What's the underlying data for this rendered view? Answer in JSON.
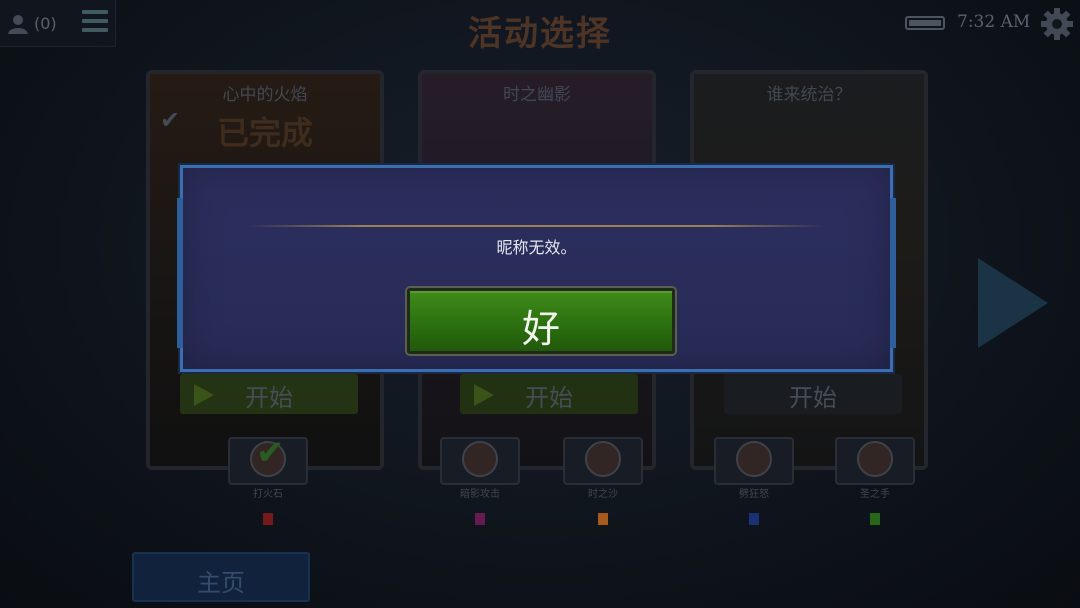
{
  "header": {
    "friends_count": "(0)",
    "page_title": "活动选择",
    "time": "7:32 AM"
  },
  "events": [
    {
      "title": "心中的火焰",
      "status": "已完成",
      "start_label": "开始"
    },
    {
      "title": "时之幽影",
      "start_label": "开始"
    },
    {
      "title": "谁来统治？",
      "start_label": "开始"
    }
  ],
  "badges": [
    {
      "name": "打火石",
      "gem_color": "#8a1f1f"
    },
    {
      "name": "暗影攻击",
      "gem_color": "#7a1f5e"
    },
    {
      "name": "时之沙",
      "gem_color": "#c46a20"
    },
    {
      "name": "劈狂怒",
      "gem_color": "#1f3a8a"
    },
    {
      "name": "圣之手",
      "gem_color": "#2f7a1f"
    }
  ],
  "footer": {
    "home_label": "主页"
  },
  "dialog": {
    "message": "昵称无效。",
    "ok_label": "好"
  },
  "colors": {
    "dialog_bg": "#2c2f5e",
    "dialog_border": "#3b6fb1",
    "ok_button": "#3f8c19"
  }
}
